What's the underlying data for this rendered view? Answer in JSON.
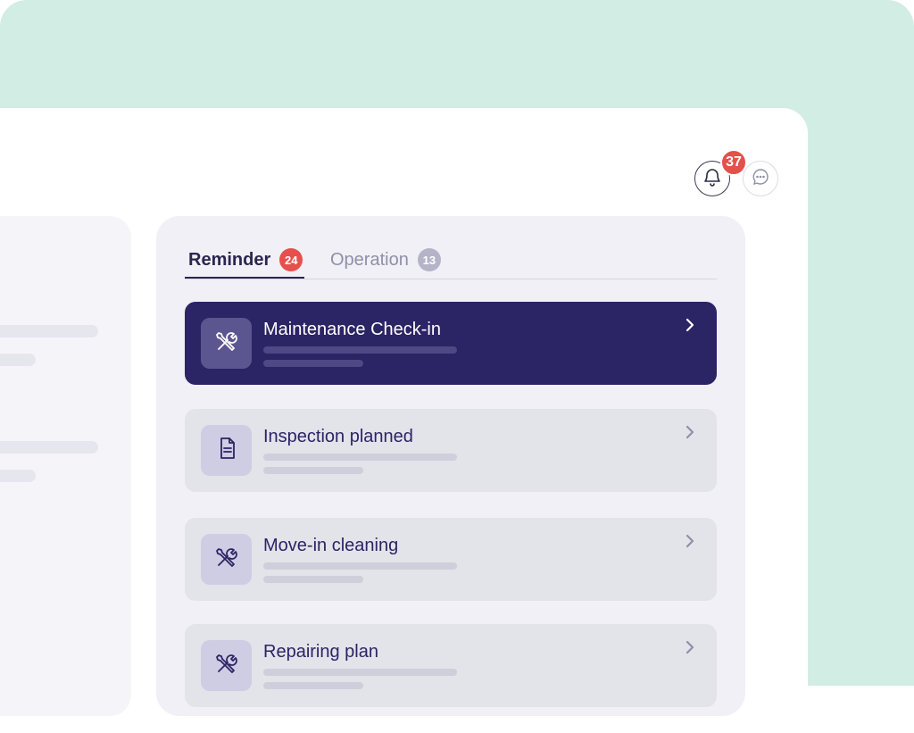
{
  "colors": {
    "background": "#d2ede3",
    "accent": "#2b2465",
    "badge": "#e5504c"
  },
  "header": {
    "notification_icon": "bell-icon",
    "notification_count": "37",
    "messages_icon": "chat-bubble-icon"
  },
  "tabs": [
    {
      "label": "Reminder",
      "count": "24",
      "selected": true
    },
    {
      "label": "Operation",
      "count": "13",
      "selected": false
    }
  ],
  "cards": [
    {
      "title": "Maintenance Check-in",
      "icon": "tools-icon",
      "selected": true
    },
    {
      "title": "Inspection planned",
      "icon": "document-icon",
      "selected": false
    },
    {
      "title": "Move-in cleaning",
      "icon": "tools-icon",
      "selected": false
    },
    {
      "title": "Repairing plan",
      "icon": "tools-icon",
      "selected": false
    }
  ]
}
